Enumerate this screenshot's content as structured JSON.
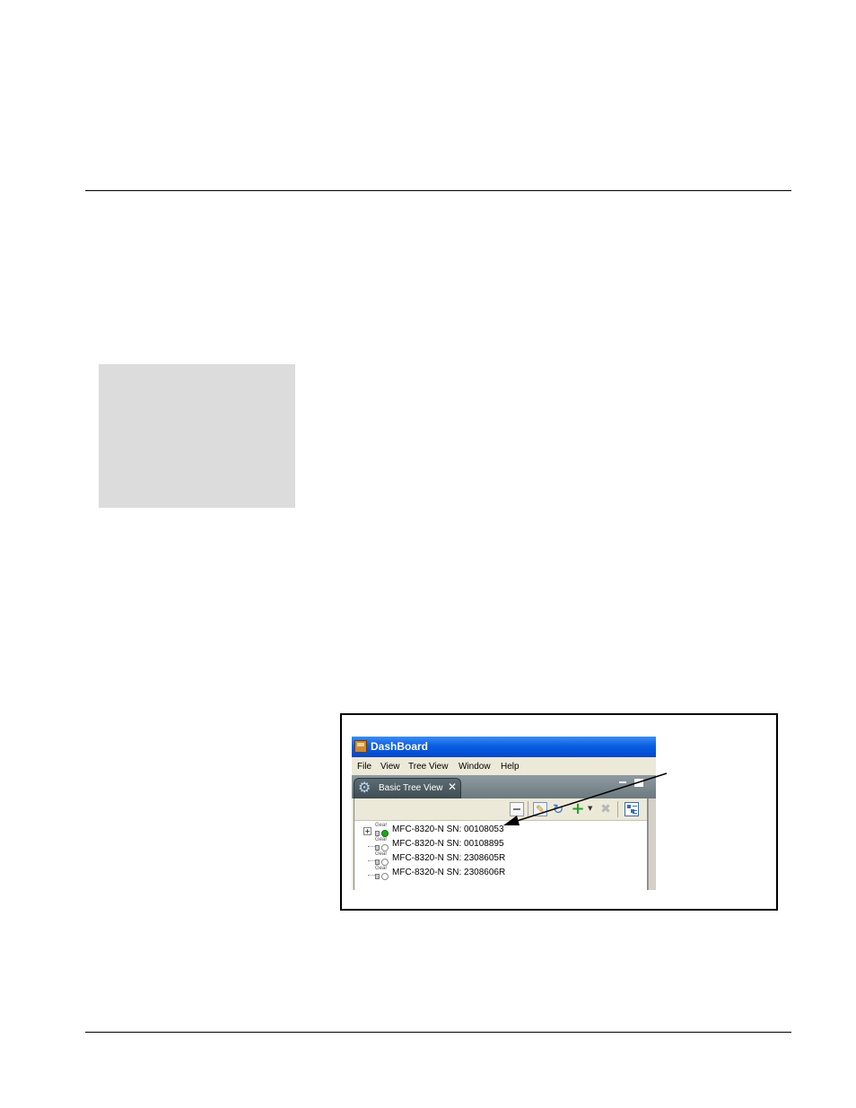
{
  "page": {
    "colors": {
      "rule": "#000000",
      "gray_box": "#dcdcdc",
      "titlebar": "#0a5fe0",
      "online_status": "#1fa81f"
    }
  },
  "figure": {
    "window": {
      "title": "DashBoard",
      "app_icon": "dashboard-app-icon"
    },
    "menu": [
      {
        "label": "File"
      },
      {
        "label": "View"
      },
      {
        "label": "Tree View"
      },
      {
        "label": "Window"
      },
      {
        "label": "Help"
      }
    ],
    "tab": {
      "label": "Basic Tree View",
      "icon": "gear-icon",
      "close_glyph": "✕"
    },
    "toolbar": {
      "buttons": [
        {
          "name": "collapse-all-icon"
        },
        {
          "name": "auto-connect-icon"
        },
        {
          "name": "refresh-icon"
        },
        {
          "name": "add-icon"
        },
        {
          "name": "remove-icon"
        },
        {
          "name": "tree-layout-icon"
        }
      ]
    },
    "tree": {
      "expander_glyph": "+",
      "device_icon_label": "Gear",
      "rows": [
        {
          "label": "MFC-8320-N SN: 00108053",
          "status": "online"
        },
        {
          "label": "MFC-8320-N SN: 00108895",
          "status": "offline"
        },
        {
          "label": "MFC-8320-N SN: 2308605R",
          "status": "offline"
        },
        {
          "label": "MFC-8320-N SN: 2308606R",
          "status": "offline"
        }
      ]
    }
  }
}
